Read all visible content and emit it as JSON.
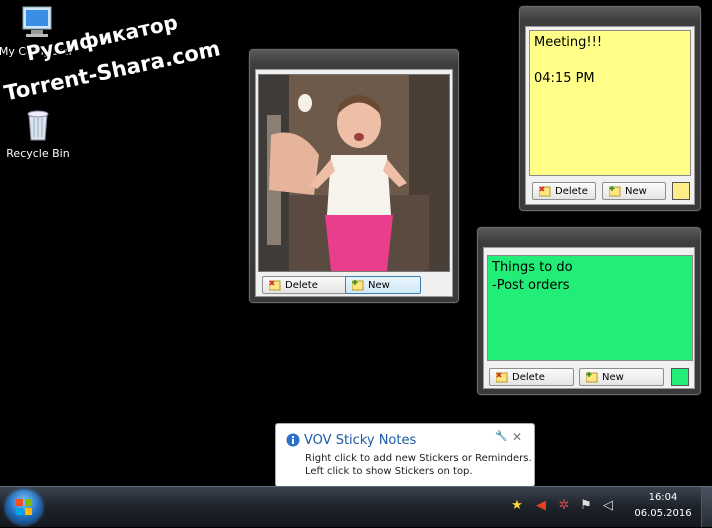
{
  "desktop": {
    "icons": [
      {
        "label": "My Computer",
        "icon": "computer-icon"
      },
      {
        "label": "Recycle Bin",
        "icon": "recycle-bin-icon"
      }
    ],
    "watermark": {
      "line1": "Русификатор",
      "line2": "Torrent-Shara.com"
    }
  },
  "notes": [
    {
      "text": "",
      "type": "photo",
      "delete_label": "Delete",
      "new_label": "New"
    },
    {
      "text": "Meeting!!!\n\n04:15 PM",
      "color": "#ffff88",
      "delete_label": "Delete",
      "new_label": "New"
    },
    {
      "text": "Things to do\n-Post orders",
      "color": "#22ee77",
      "delete_label": "Delete",
      "new_label": "New"
    }
  ],
  "balloon": {
    "title": "VOV Sticky Notes",
    "line1": "Right click to add new Stickers or Reminders.",
    "line2": "Left click to show Stickers on top.",
    "icon": "info-icon",
    "settings_icon": "wrench-icon",
    "close_icon": "close-icon"
  },
  "taskbar": {
    "time": "16:04",
    "date": "06.05.2016",
    "tray_icons": [
      "sticky-notes-tray-icon",
      "volume-muted-icon",
      "network-icon",
      "action-center-icon",
      "speaker-icon"
    ]
  }
}
